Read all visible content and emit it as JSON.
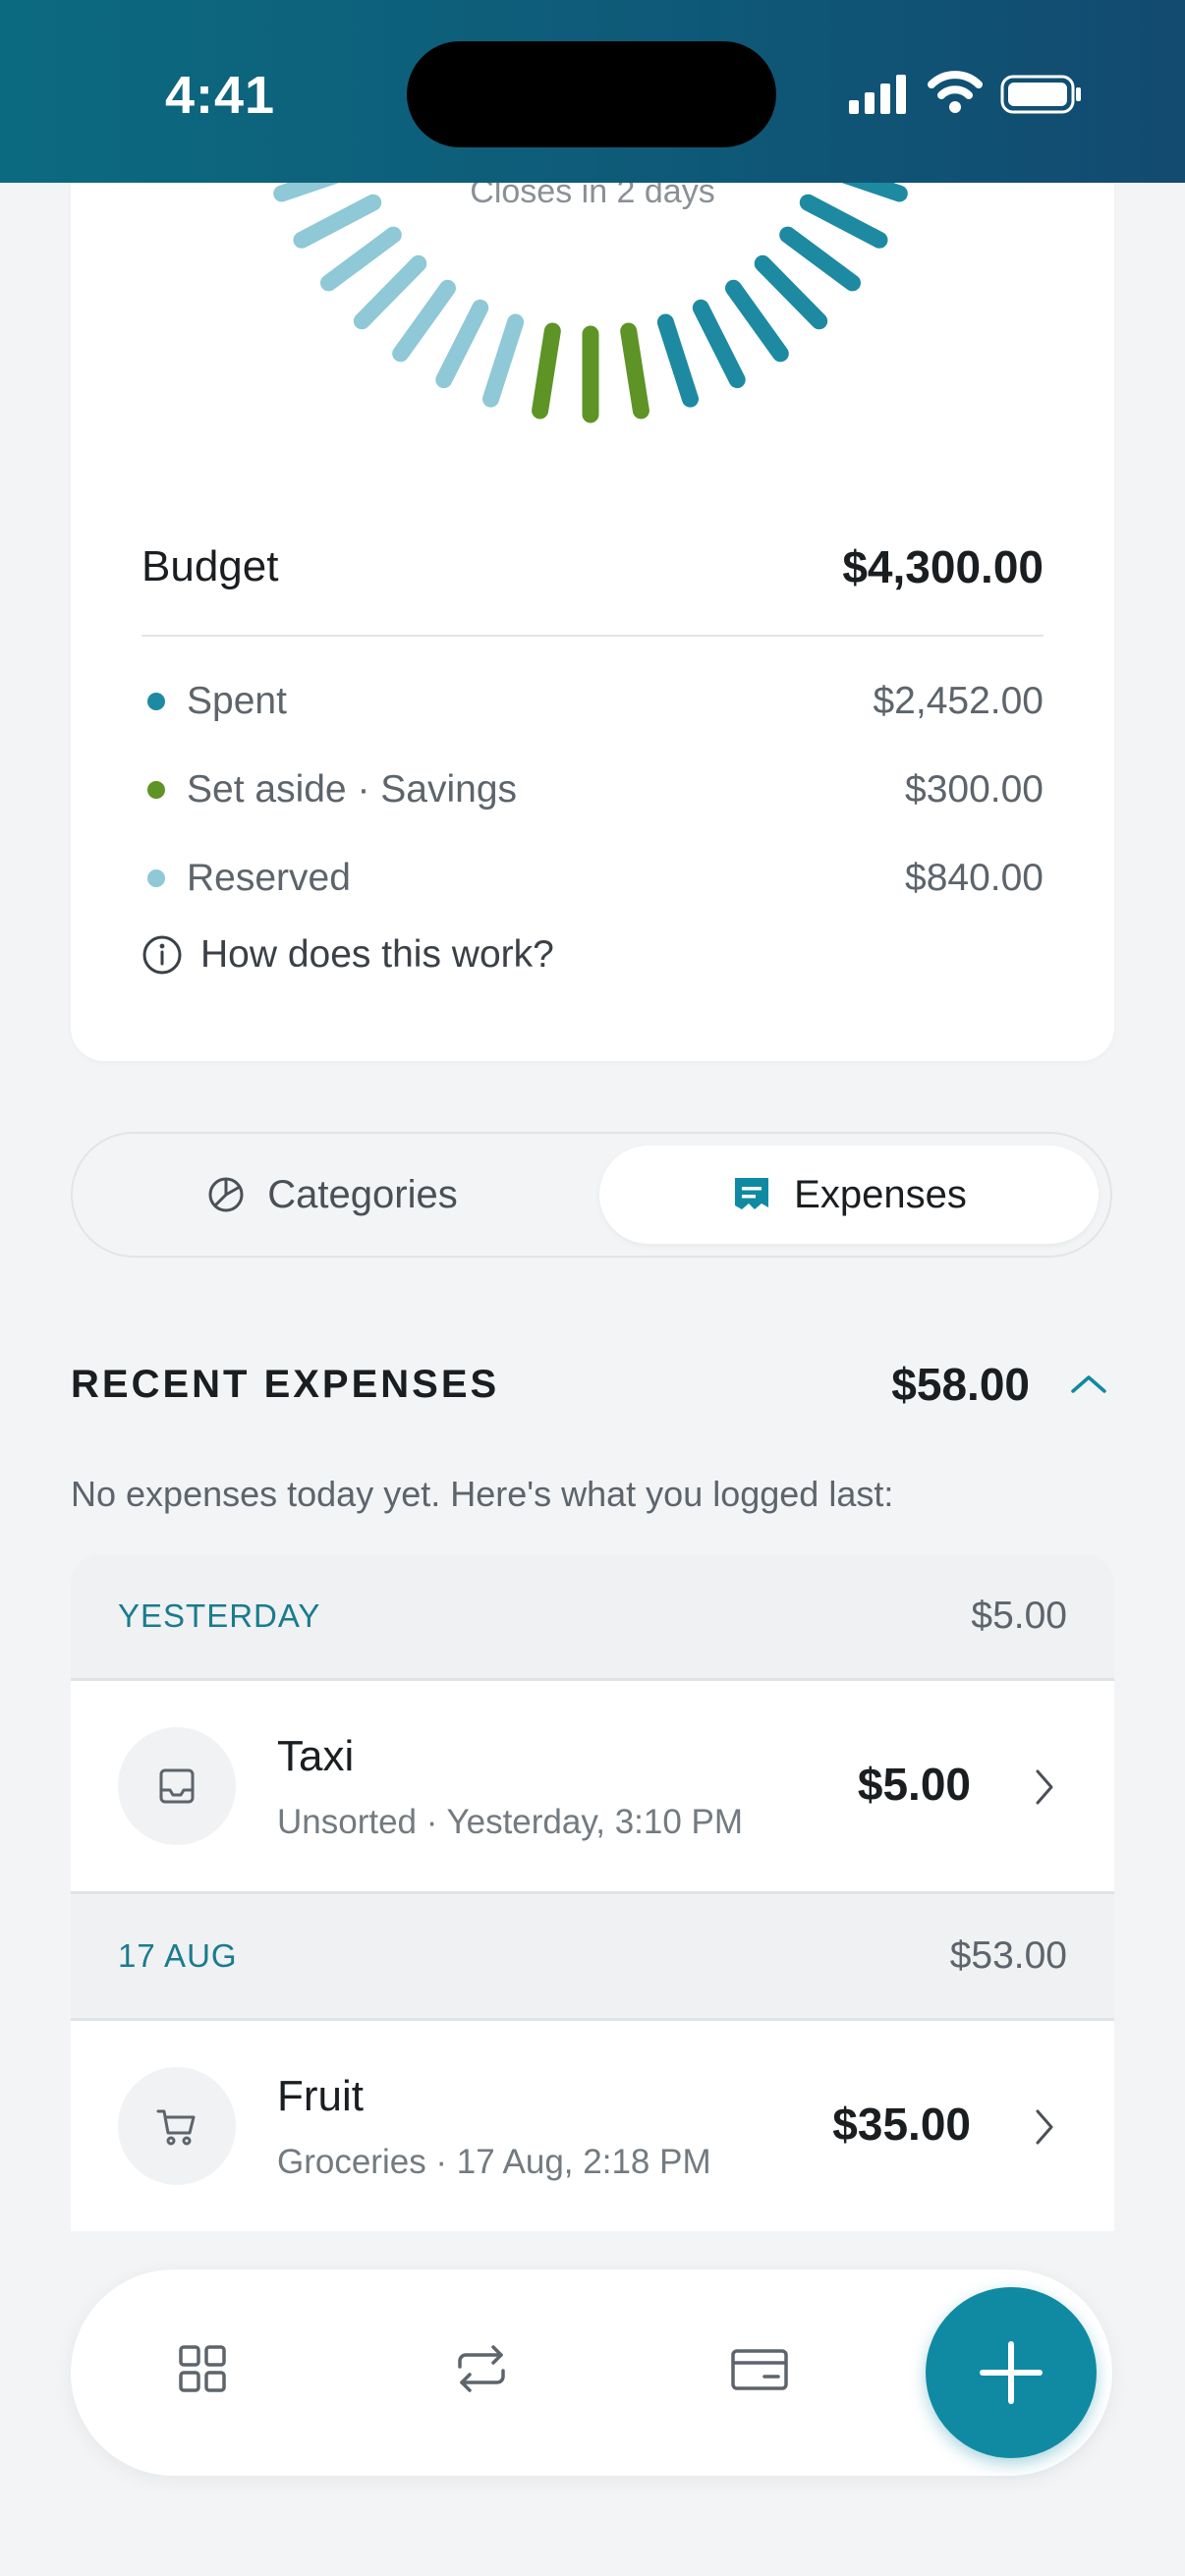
{
  "status_bar": {
    "time": "4:41"
  },
  "budget_card": {
    "closes_text": "Closes in 2 days",
    "budget_label": "Budget",
    "budget_value": "$4,300.00",
    "rows": [
      {
        "label": "Spent",
        "value": "$2,452.00",
        "color": "#1d8aa2"
      },
      {
        "label": "Set aside · Savings",
        "value": "$300.00",
        "color": "#5e9326"
      },
      {
        "label": "Reserved",
        "value": "$840.00",
        "color": "#8fc8d6"
      }
    ],
    "help_link": "How does this work?"
  },
  "segmented": {
    "tabs": [
      {
        "label": "Categories",
        "icon": "pie-chart-icon",
        "active": false
      },
      {
        "label": "Expenses",
        "icon": "receipt-icon",
        "active": true
      }
    ]
  },
  "recent": {
    "title": "RECENT EXPENSES",
    "total": "$58.00",
    "subtitle": "No expenses today yet. Here's what you logged last:",
    "groups": [
      {
        "label": "YESTERDAY",
        "total": "$5.00",
        "items": [
          {
            "title": "Taxi",
            "subtitle": "Unsorted · Yesterday, 3:10 PM",
            "amount": "$5.00",
            "icon": "inbox-icon"
          }
        ]
      },
      {
        "label": "17 AUG",
        "total": "$53.00",
        "items": [
          {
            "title": "Fruit",
            "subtitle": "Groceries · 17 Aug, 2:18 PM",
            "amount": "$35.00",
            "icon": "cart-icon"
          }
        ]
      }
    ]
  },
  "bottom_nav": {
    "items": [
      {
        "icon": "grid-icon"
      },
      {
        "icon": "repeat-icon"
      },
      {
        "icon": "card-icon"
      }
    ],
    "fab_icon": "plus-icon"
  },
  "colors": {
    "accent": "#0f8aa2",
    "spent": "#1d8aa2",
    "savings": "#5e9326",
    "reserved": "#8fc8d6",
    "header": "#0e5a78"
  }
}
